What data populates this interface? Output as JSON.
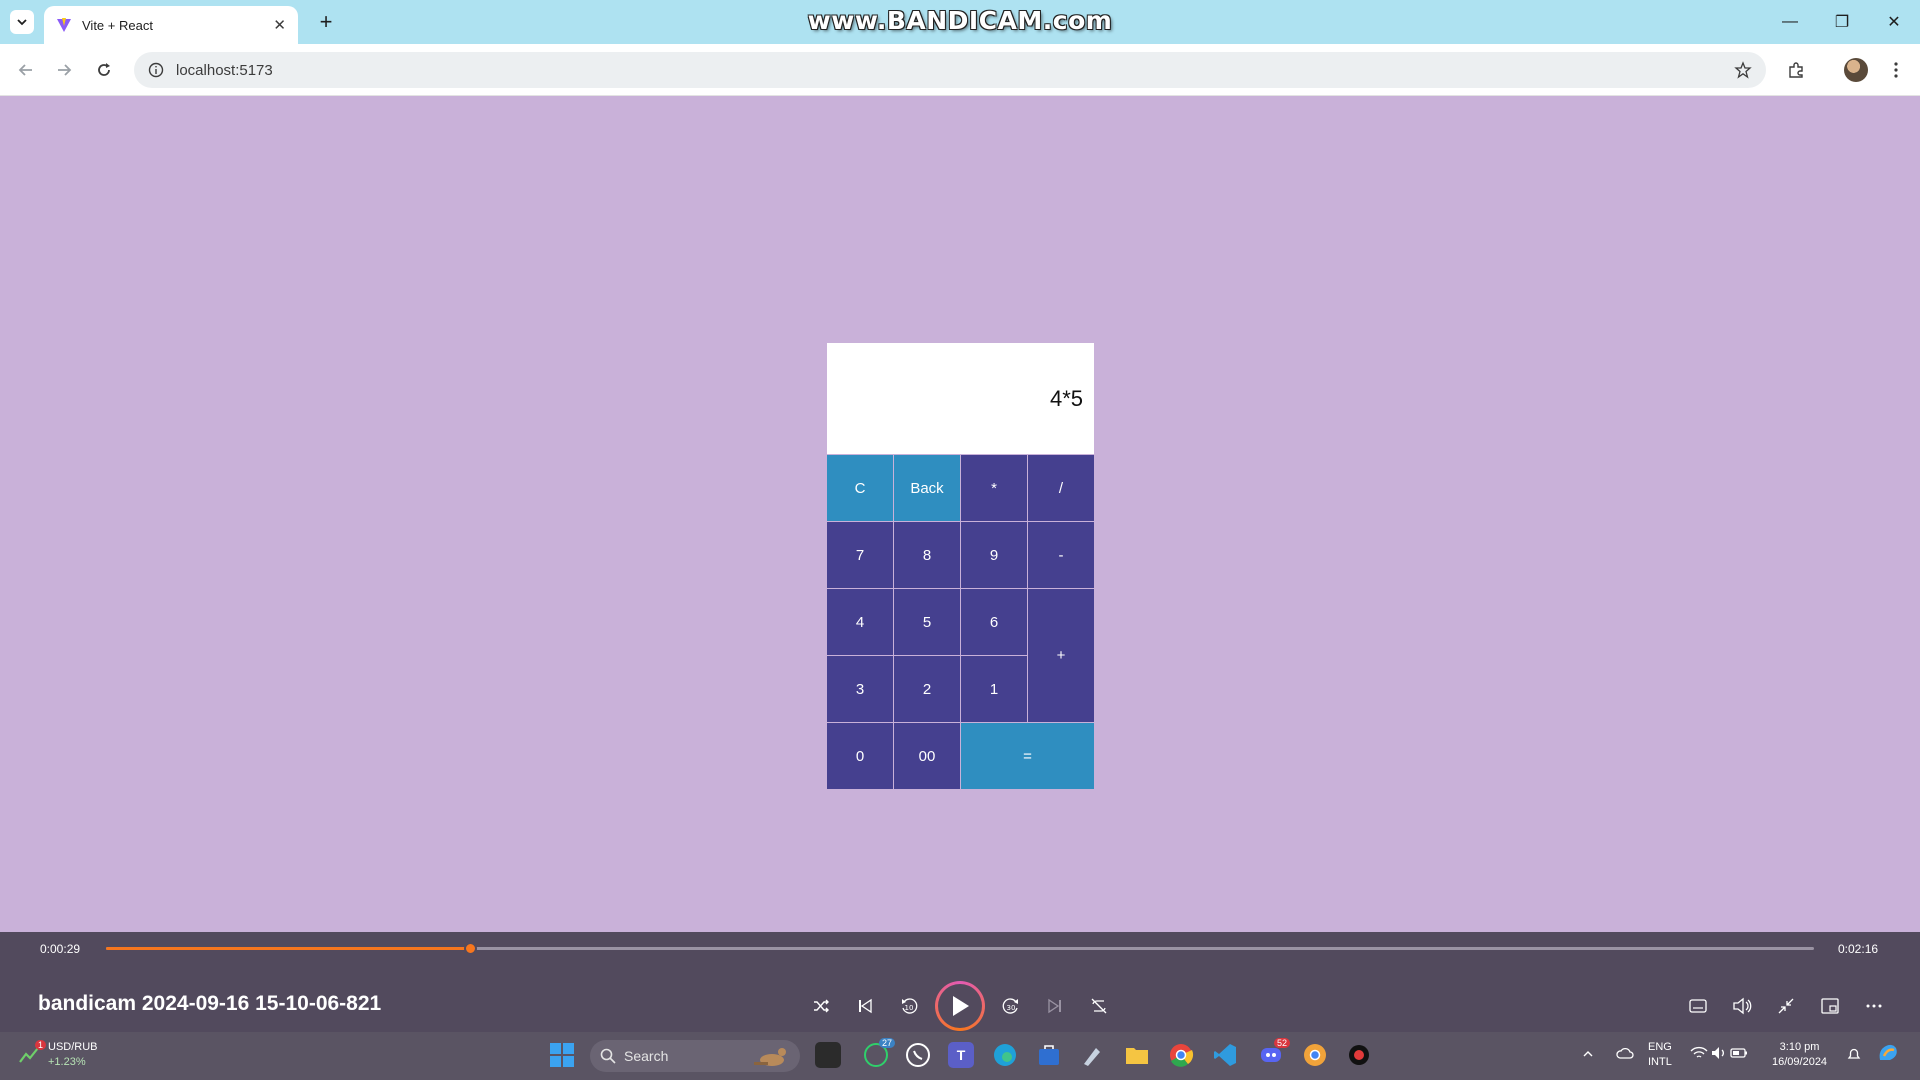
{
  "browser": {
    "tab_title": "Vite + React",
    "url": "localhost:5173",
    "watermark": "www.BANDICAM.com"
  },
  "calculator": {
    "display": "4*5",
    "keys": {
      "clear": "C",
      "back": "Back",
      "multiply": "*",
      "divide": "/",
      "seven": "7",
      "eight": "8",
      "nine": "9",
      "minus": "-",
      "four": "4",
      "five": "5",
      "six": "6",
      "plus": "+",
      "three": "3",
      "two": "2",
      "one": "1",
      "zero": "0",
      "double_zero": "00",
      "equals": "="
    },
    "colors": {
      "operator": "#45408f",
      "function": "#2f8ec0",
      "background": "#c9b1d9"
    }
  },
  "player": {
    "current_time": "0:00:29",
    "total_time": "0:02:16",
    "progress": 0.213,
    "title": "bandicam 2024-09-16 15-10-06-821",
    "accent": "#f7761e"
  },
  "taskbar": {
    "widget_title": "USD/RUB",
    "widget_change": "+1.23%",
    "widget_badge": "1",
    "search_placeholder": "Search",
    "whatsapp_badge": "27",
    "discord_badge": "52",
    "lang_top": "ENG",
    "lang_bottom": "INTL",
    "time": "3:10 pm",
    "date": "16/09/2024"
  }
}
